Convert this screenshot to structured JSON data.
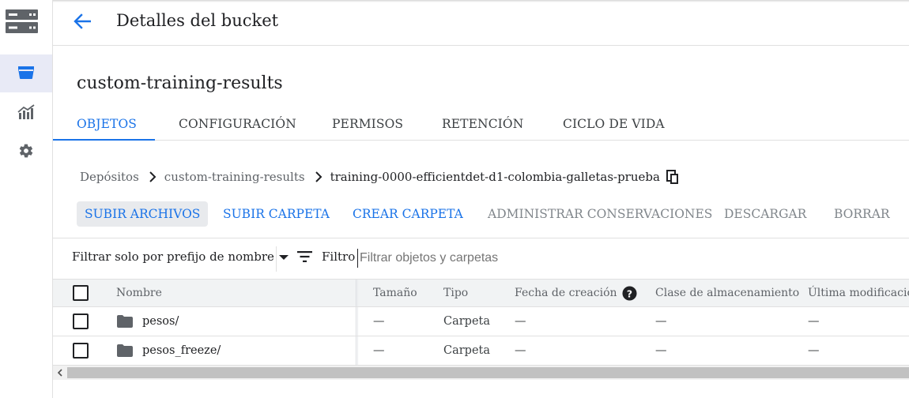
{
  "header": {
    "title": "Detalles del bucket"
  },
  "bucket": {
    "name": "custom-training-results"
  },
  "tabs": [
    {
      "label": "OBJETOS"
    },
    {
      "label": "CONFIGURACIÓN"
    },
    {
      "label": "PERMISOS"
    },
    {
      "label": "RETENCIÓN"
    },
    {
      "label": "CICLO DE VIDA"
    }
  ],
  "breadcrumb": [
    {
      "label": "Depósitos"
    },
    {
      "label": "custom-training-results"
    },
    {
      "label": "training-0000-efficientdet-d1-colombia-galletas-prueba"
    }
  ],
  "actions": [
    {
      "label": "SUBIR ARCHIVOS"
    },
    {
      "label": "SUBIR CARPETA"
    },
    {
      "label": "CREAR CARPETA"
    },
    {
      "label": "ADMINISTRAR CONSERVACIONES"
    },
    {
      "label": "DESCARGAR"
    },
    {
      "label": "BORRAR"
    }
  ],
  "filter": {
    "prefix_select": "Filtrar solo por prefijo de nombre",
    "filter_label": "Filtro",
    "placeholder": "Filtrar objetos y carpetas"
  },
  "table": {
    "columns": [
      "Nombre",
      "Tamaño",
      "Tipo",
      "Fecha de creación",
      "Clase de almacenamiento",
      "Última modificación"
    ],
    "rows": [
      {
        "name": "pesos/",
        "size": "—",
        "type": "Carpeta",
        "created": "—",
        "storage_class": "—",
        "modified": "—"
      },
      {
        "name": "pesos_freeze/",
        "size": "—",
        "type": "Carpeta",
        "created": "—",
        "storage_class": "—",
        "modified": "—"
      }
    ]
  },
  "colors": {
    "accent": "#1a73e8",
    "active_rail": "#1a73e8",
    "rail_icon": "#5f6368"
  }
}
